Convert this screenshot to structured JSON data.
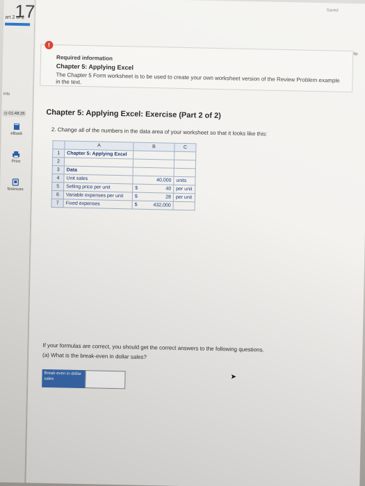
{
  "header": {
    "saved": "Saved",
    "help": "Help"
  },
  "sidebar": {
    "question_number": "17",
    "part": "art 2 of 2",
    "points": "ints",
    "timer": "01:48:26",
    "buttons": [
      {
        "label": "eBook",
        "icon": "book-icon"
      },
      {
        "label": "Print",
        "icon": "print-icon"
      },
      {
        "label": "ferences",
        "icon": "references-icon"
      }
    ]
  },
  "required_info": {
    "title": "Required information",
    "subtitle": "Chapter 5: Applying Excel",
    "text": "The Chapter 5 Form worksheet is to be used to create your own worksheet version of the Review Problem example in the text."
  },
  "exercise": {
    "title": "Chapter 5: Applying Excel: Exercise (Part 2 of 2)",
    "instruction": "2. Change all of the numbers in the data area of your worksheet so that it looks like this:"
  },
  "sheet": {
    "columns": [
      "",
      "A",
      "B",
      "C"
    ],
    "rows": [
      {
        "n": "1",
        "a": "Chapter 5: Applying Excel",
        "cur": "",
        "b": "",
        "c": "",
        "bold": true
      },
      {
        "n": "2",
        "a": "",
        "cur": "",
        "b": "",
        "c": "",
        "bold": false
      },
      {
        "n": "3",
        "a": "Data",
        "cur": "",
        "b": "",
        "c": "",
        "bold": true
      },
      {
        "n": "4",
        "a": "Unit sales",
        "cur": "",
        "b": "40,000",
        "c": "units",
        "bold": false
      },
      {
        "n": "5",
        "a": "Selling price per unit",
        "cur": "$",
        "b": "40",
        "c": "per unit",
        "bold": false
      },
      {
        "n": "6",
        "a": "Variable expenses per unit",
        "cur": "$",
        "b": "28",
        "c": "per unit",
        "bold": false
      },
      {
        "n": "7",
        "a": "Fixed expenses",
        "cur": "$",
        "b": "432,000",
        "c": "",
        "bold": false
      }
    ]
  },
  "questions": {
    "intro": "If your formulas are correct, you should get the correct answers to the following questions.",
    "q_a": "(a) What is the break-even in dollar sales?",
    "answer_label": "Break-even in dollar sales",
    "answer_value": ""
  },
  "colors": {
    "accent": "#1f6fc5",
    "alert": "#d23b2b",
    "answer_label_bg": "#3c6db3"
  }
}
